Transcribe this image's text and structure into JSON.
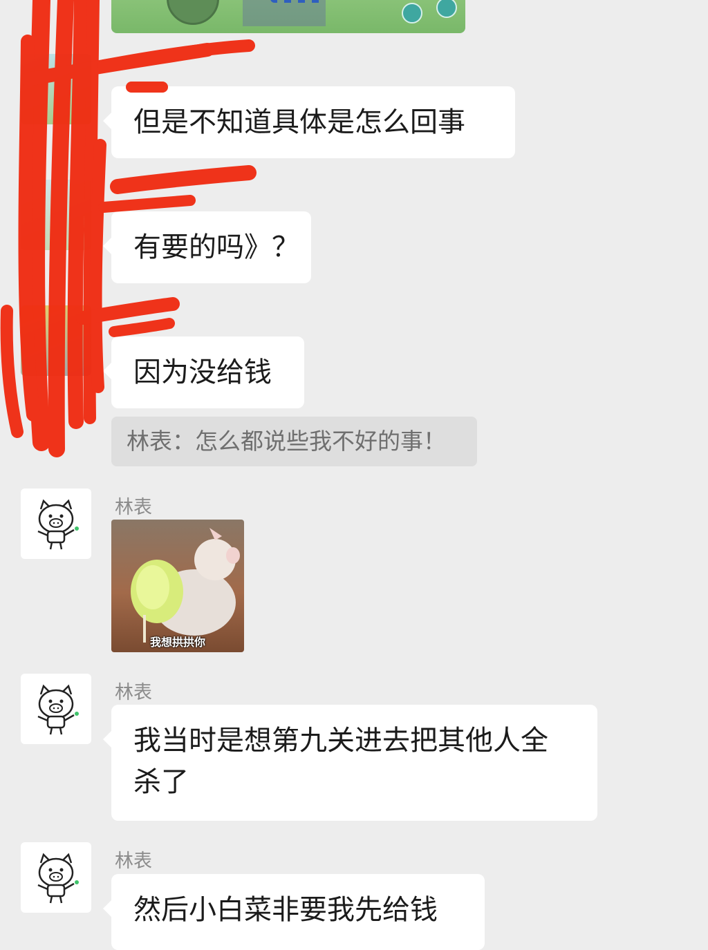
{
  "messages": [
    {
      "sender": "",
      "text": "但是不知道具体是怎么回事"
    },
    {
      "sender": "",
      "text": "有要的吗》？"
    },
    {
      "sender": "",
      "text": "因为没给钱"
    }
  ],
  "system_notice": "林表：怎么都说些我不好的事！",
  "sticker_message": {
    "sender": "林表",
    "caption": "我想拱拱你"
  },
  "messages_after": [
    {
      "sender": "林表",
      "text": "我当时是想第九关进去把其他人全杀了"
    },
    {
      "sender": "林表",
      "text": "然后小白菜非要我先给钱"
    }
  ],
  "colors": {
    "background": "#ededed",
    "bubble": "#ffffff",
    "system_pill": "#dedede",
    "redaction": "#f02c12"
  },
  "icons": {
    "avatar_pig": "pig-cartoon-avatar-icon",
    "avatar_blurred": "redacted-avatar-icon"
  }
}
